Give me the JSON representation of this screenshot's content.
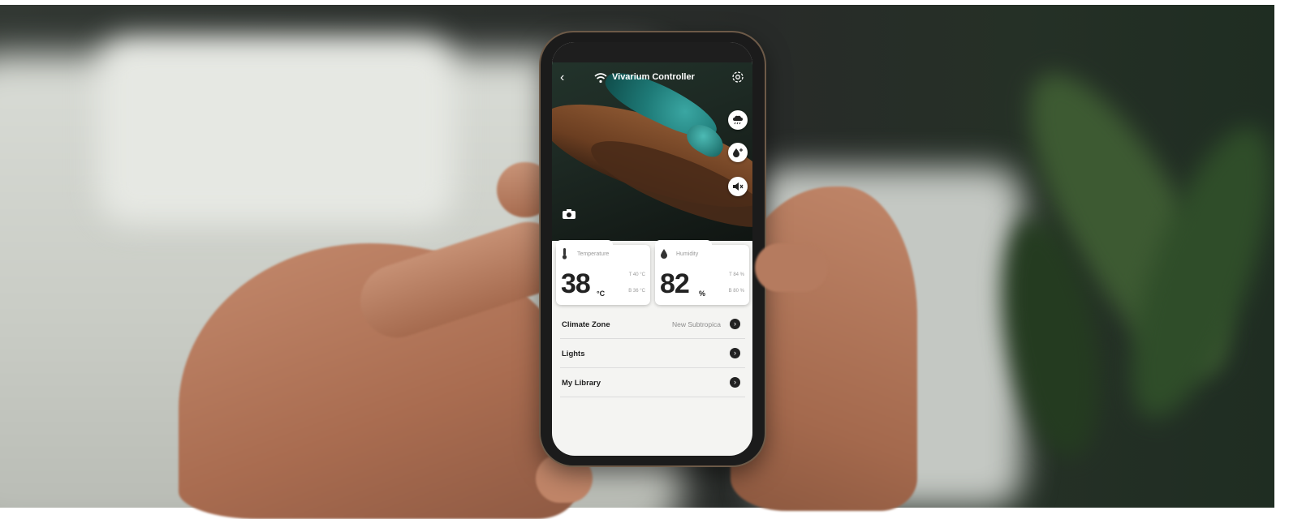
{
  "app": {
    "title": "Vivarium Controller"
  },
  "icons": {
    "back": "back-arrow-icon",
    "wifi": "wifi-icon",
    "settings": "gear-icon",
    "rain": "rain-cloud-icon",
    "humidity_plus": "droplet-plus-icon",
    "mute": "speaker-mute-icon",
    "camera": "camera-icon"
  },
  "sensors": {
    "temperature": {
      "label": "Temperature",
      "value": "38",
      "unit": "°C",
      "max": "T 40 °C",
      "min": "B 36 °C"
    },
    "humidity": {
      "label": "Humidity",
      "value": "82",
      "unit": "%",
      "max": "T 84 %",
      "min": "B 80 %"
    }
  },
  "menu": {
    "items": [
      {
        "label": "Climate Zone",
        "value": "New Subtropica"
      },
      {
        "label": "Lights",
        "value": ""
      },
      {
        "label": "My Library",
        "value": ""
      }
    ]
  },
  "colors": {
    "screen_bg": "#f4f4f2",
    "text_dark": "#222222",
    "accent_teal": "#1e7a77"
  }
}
